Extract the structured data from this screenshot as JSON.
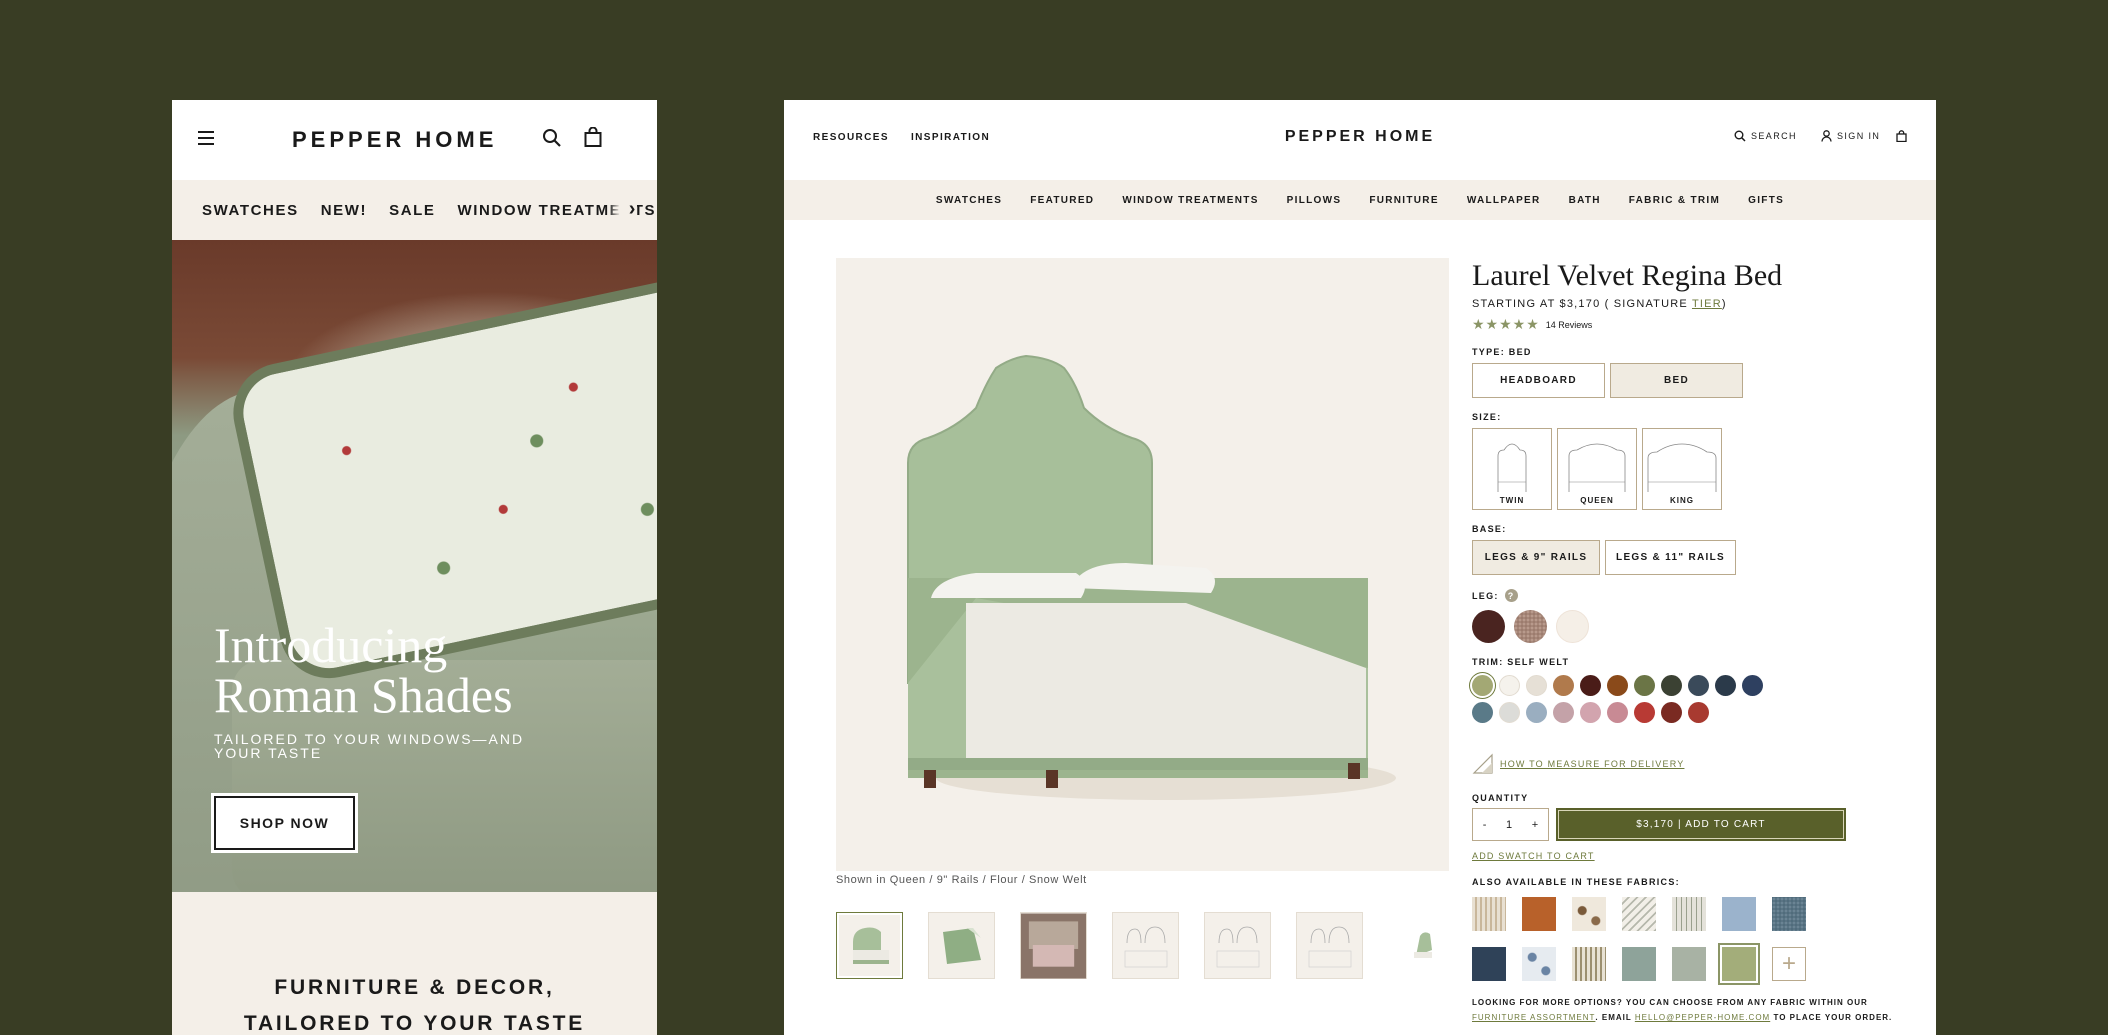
{
  "mobile": {
    "logo": "PEPPER HOME",
    "nav": [
      "SWATCHES",
      "NEW!",
      "SALE",
      "WINDOW TREATMENTS"
    ],
    "nav_more": "›",
    "hero": {
      "title_line1": "Introducing",
      "title_line2": "Roman Shades",
      "subtitle": "TAILORED TO YOUR WINDOWS—AND YOUR TASTE",
      "cta": "SHOP NOW"
    },
    "tagline_line1": "FURNITURE & DECOR,",
    "tagline_line2": "TAILORED TO YOUR TASTE"
  },
  "desktop": {
    "util_left": [
      "RESOURCES",
      "INSPIRATION"
    ],
    "logo": "PEPPER HOME",
    "search_label": "SEARCH",
    "signin_label": "SIGN IN",
    "nav": [
      "SWATCHES",
      "FEATURED",
      "WINDOW TREATMENTS",
      "PILLOWS",
      "FURNITURE",
      "WALLPAPER",
      "BATH",
      "FABRIC & TRIM",
      "GIFTS"
    ],
    "image_caption": "Shown in Queen / 9\" Rails / Flour / Snow Welt"
  },
  "product": {
    "title": "Laurel Velvet Regina Bed",
    "price_prefix": "STARTING AT $3,170 ( SIGNATURE ",
    "price_tier": "TIER",
    "price_suffix": ")",
    "stars": "★★★★★",
    "reviews": "14 Reviews",
    "type_label": "TYPE: BED",
    "types": [
      {
        "label": "HEADBOARD",
        "selected": false
      },
      {
        "label": "BED",
        "selected": true
      }
    ],
    "size_label": "SIZE:",
    "sizes": [
      "TWIN",
      "QUEEN",
      "KING"
    ],
    "base_label": "BASE:",
    "bases": [
      {
        "label": "LEGS & 9\" RAILS",
        "selected": true
      },
      {
        "label": "LEGS & 11\" RAILS",
        "selected": false
      }
    ],
    "leg_label": "LEG:",
    "leg_help": "?",
    "legs": [
      "#4a2420",
      "#a98a7e",
      "#f5efe7"
    ],
    "trim_label": "TRIM: SELF WELT",
    "trims": [
      "#a3a874",
      "#f5f2ec",
      "#e6e0d6",
      "#b07a4c",
      "#4a1c18",
      "#8a4a1a",
      "#6b7546",
      "#3b4133",
      "#3a4a5a",
      "#2b3a4a",
      "#2e4060",
      "#5a7a88",
      "#dcdcd8",
      "#9aaec0",
      "#c4a2a8",
      "#d2a4ae",
      "#c88a94",
      "#b83a34",
      "#7a2a22",
      "#a83a30"
    ],
    "measure_label": "HOW TO MEASURE FOR DELIVERY",
    "quantity_label": "QUANTITY",
    "qty_minus": "-",
    "qty_value": "1",
    "qty_plus": "+",
    "add_to_cart": "$3,170 | ADD TO CART",
    "add_swatch": "ADD SWATCH TO CART",
    "fabrics_label": "ALSO AVAILABLE IN THESE FABRICS:",
    "fabric_plus": "+",
    "more_text": "LOOKING FOR MORE OPTIONS? YOU CAN CHOOSE FROM ANY FABRIC WITHIN OUR",
    "more_link1": "FURNITURE ASSORTMENT",
    "more_mid": ". EMAIL",
    "more_link2": "HELLO@PEPPER-HOME.COM",
    "more_end": "TO PLACE YOUR ORDER."
  },
  "colors": {
    "background": "#393d24",
    "accent": "#59602a",
    "panel_cream": "#f4efe8"
  }
}
